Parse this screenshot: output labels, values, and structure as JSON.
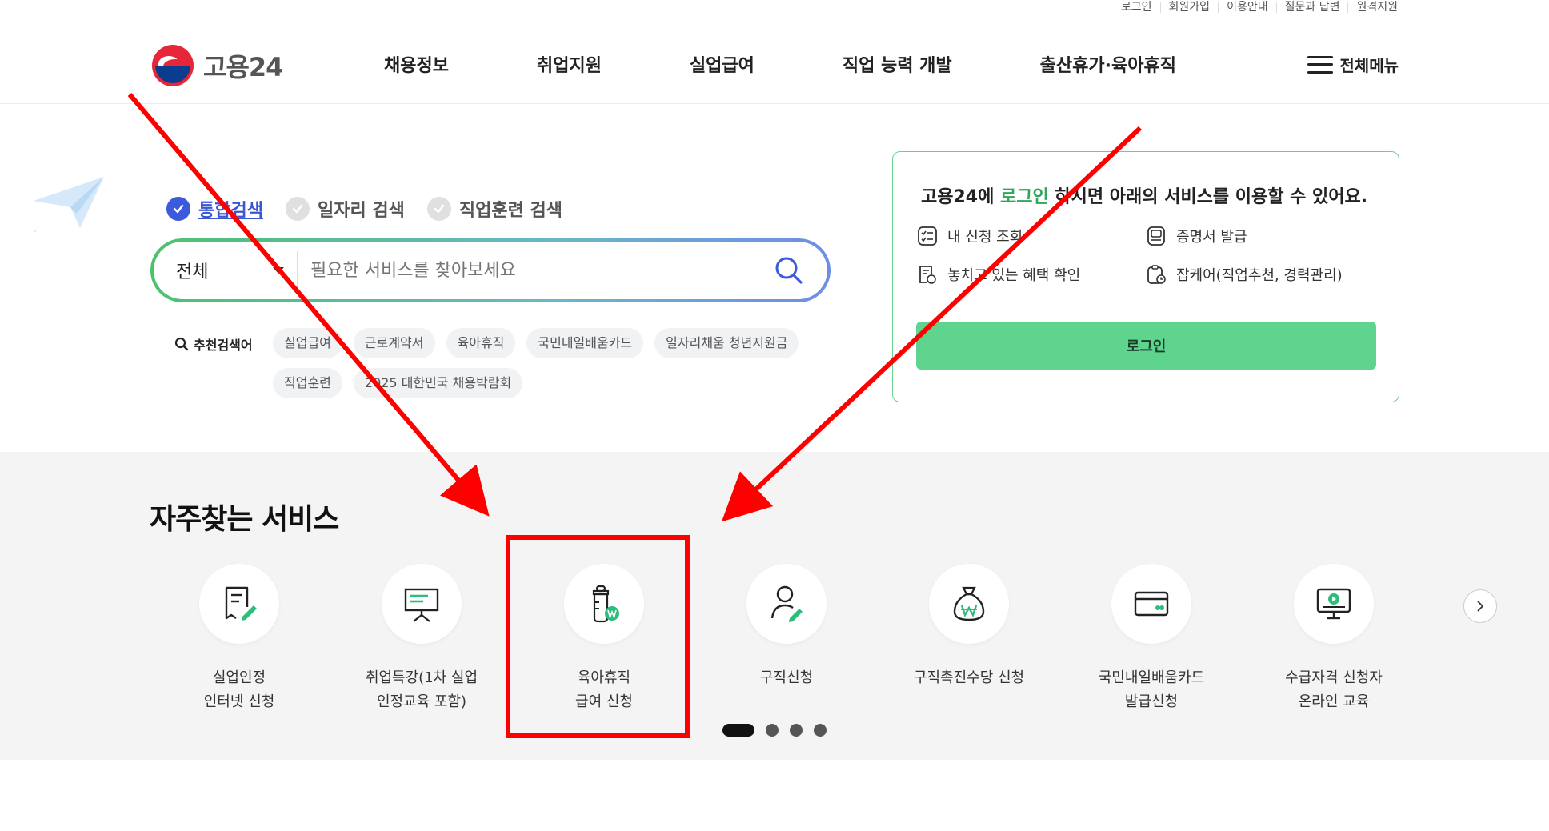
{
  "util": [
    "로그인",
    "회원가입",
    "이용안내",
    "질문과 답변",
    "원격지원"
  ],
  "logo": {
    "text": "고용24"
  },
  "gnb": [
    "채용정보",
    "취업지원",
    "실업급여",
    "직업 능력 개발",
    "출산휴가·육아휴직"
  ],
  "all_menu": "전체메뉴",
  "search": {
    "tabs": [
      "통합검색",
      "일자리 검색",
      "직업훈련 검색"
    ],
    "active_tab": "통합검색",
    "select_value": "전체",
    "placeholder": "필요한 서비스를 찾아보세요",
    "reco_label": "추천검색어",
    "chips": [
      "실업급여",
      "근로계약서",
      "육아휴직",
      "국민내일배움카드",
      "일자리채움 청년지원금",
      "직업훈련",
      "2025 대한민국 채용박람회"
    ]
  },
  "login_card": {
    "msg_prefix": "고용24에 ",
    "msg_highlight": "로그인",
    "msg_suffix": " 하시면 아래의 서비스를 이용할 수 있어요.",
    "services": [
      "내 신청 조회",
      "증명서 발급",
      "놓치고 있는 혜택 확인",
      "잡케어(직업추천, 경력관리)"
    ],
    "button": "로그인"
  },
  "frequent": {
    "title": "자주찾는 서비스",
    "items": [
      {
        "label": "실업인정\n인터넷 신청",
        "icon": "document-pen-icon"
      },
      {
        "label": "취업특강(1차 실업\n인정교육 포함)",
        "icon": "presentation-board-icon"
      },
      {
        "label": "육아휴직\n급여 신청",
        "icon": "baby-bottle-won-icon"
      },
      {
        "label": "구직신청",
        "icon": "person-pen-icon"
      },
      {
        "label": "구직촉진수당 신청",
        "icon": "money-bag-icon"
      },
      {
        "label": "국민내일배움카드\n발급신청",
        "icon": "card-icon"
      },
      {
        "label": "수급자격 신청자\n온라인 교육",
        "icon": "monitor-play-icon"
      }
    ],
    "pagination": {
      "current": 1,
      "total": 4
    }
  },
  "colors": {
    "accent_green": "#5fd48f",
    "highlight_red": "#ff0000",
    "tab_blue": "#3b5bdb"
  }
}
